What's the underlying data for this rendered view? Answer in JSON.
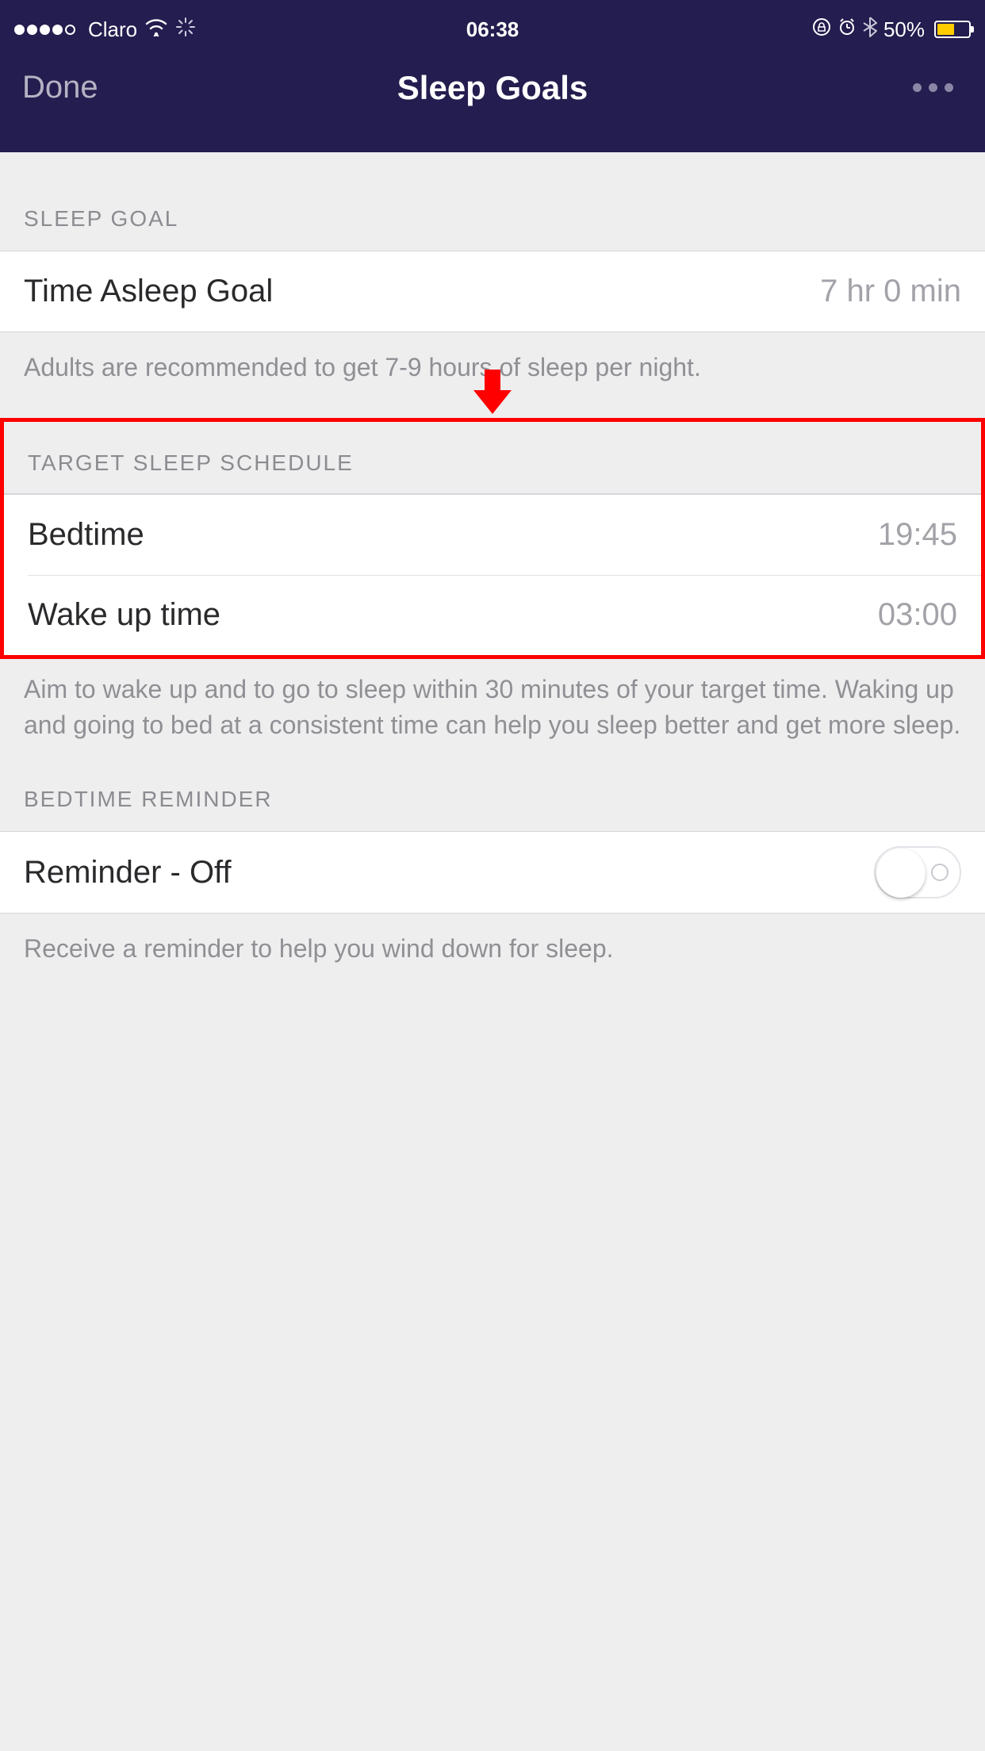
{
  "status": {
    "carrier": "Claro",
    "time": "06:38",
    "battery_pct": "50%"
  },
  "nav": {
    "done": "Done",
    "title": "Sleep Goals"
  },
  "sections": {
    "sleep_goal": {
      "header": "SLEEP GOAL",
      "row_label": "Time Asleep Goal",
      "row_value": "7 hr 0 min",
      "footer": "Adults are recommended to get 7-9 hours of sleep per night."
    },
    "target_schedule": {
      "header": "TARGET SLEEP SCHEDULE",
      "bedtime_label": "Bedtime",
      "bedtime_value": "19:45",
      "wake_label": "Wake up time",
      "wake_value": "03:00",
      "footer": "Aim to wake up and to go to sleep within 30 minutes of your target time. Waking up and going to bed at a consistent time can help you sleep better and get more sleep."
    },
    "reminder": {
      "header": "BEDTIME REMINDER",
      "label": "Reminder - Off",
      "state": "off",
      "footer": "Receive a reminder to help you wind down for sleep."
    }
  },
  "annotation": {
    "arrow_color": "#ff0000",
    "highlight_color": "#ff0000"
  }
}
